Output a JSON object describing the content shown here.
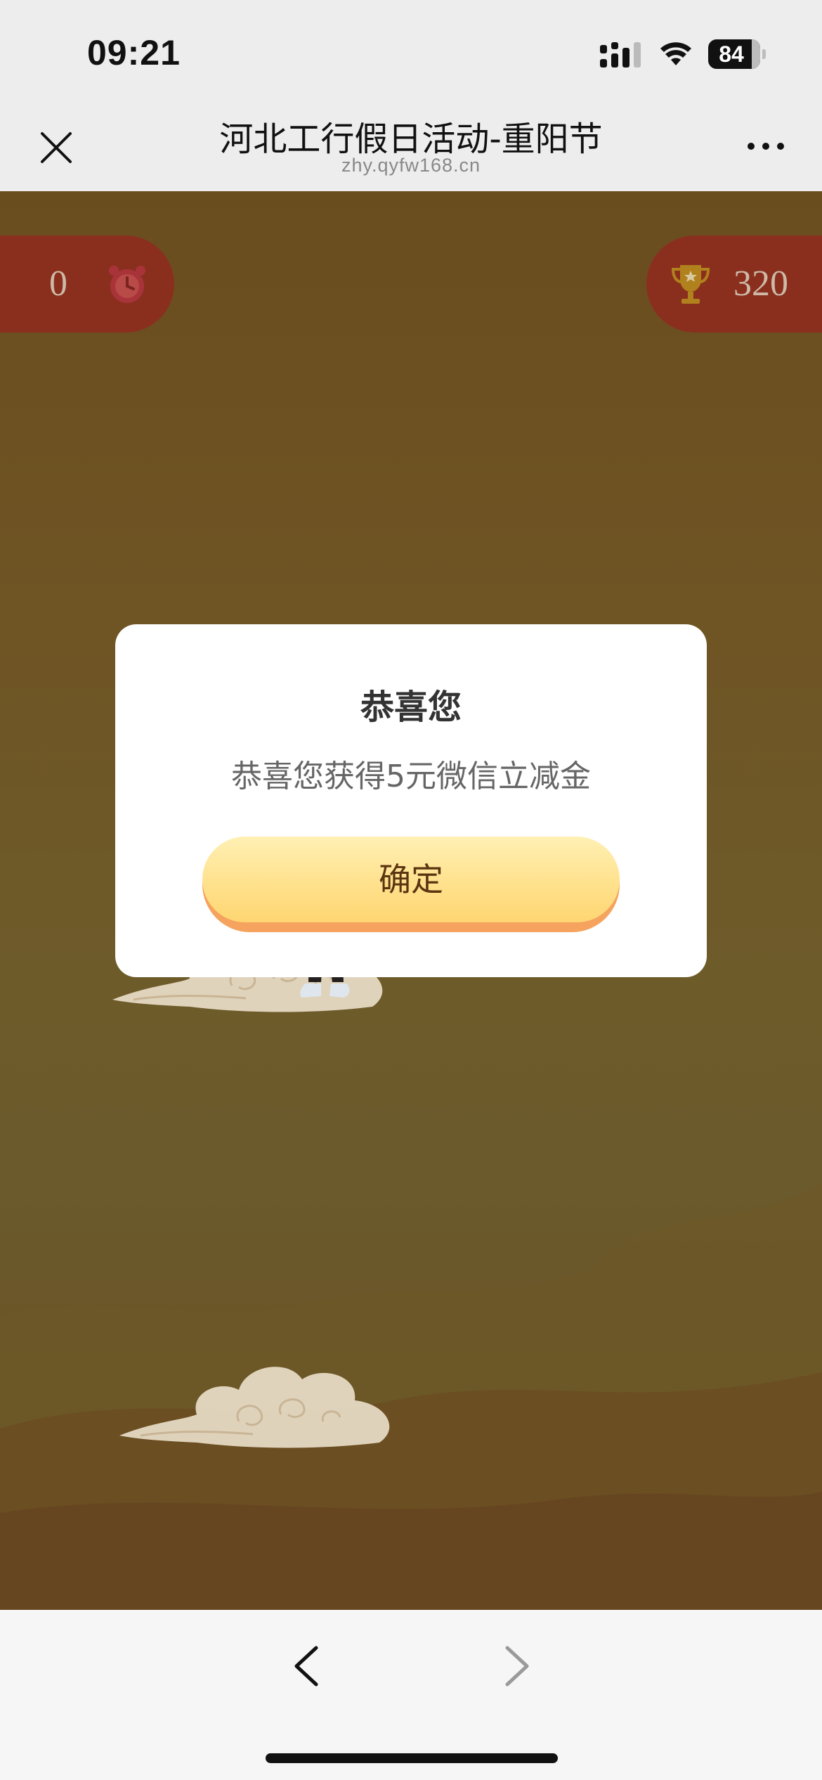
{
  "status_bar": {
    "time": "09:21",
    "battery_level": "84",
    "icons": [
      "signal-icon",
      "wifi-icon",
      "battery-icon"
    ]
  },
  "nav": {
    "title": "河北工行假日活动-重阳节",
    "domain": "zhy.qyfw168.cn",
    "icons": [
      "close-icon",
      "more-icon"
    ]
  },
  "game": {
    "timer_value": "0",
    "score_value": "320",
    "icons": [
      "clock-icon",
      "trophy-icon",
      "cloud",
      "character"
    ]
  },
  "modal": {
    "title": "恭喜您",
    "message": "恭喜您获得5元微信立减金",
    "confirm_label": "确定"
  },
  "bottom_bar": {
    "icons": [
      "back-icon",
      "forward-icon"
    ]
  },
  "colors": {
    "game_background": "#6e5a2a",
    "pill": "#8a2f1e",
    "button_top": "#fff0b4",
    "button_bottom": "#ffd672",
    "button_shadow": "#f5a35e"
  }
}
